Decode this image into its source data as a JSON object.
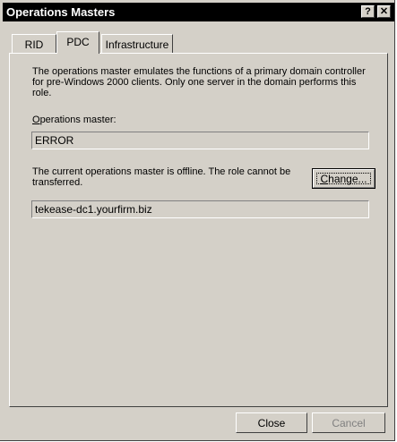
{
  "window": {
    "title": "Operations Masters",
    "help_label": "?",
    "close_label": "✕"
  },
  "tabs": [
    {
      "label": "RID",
      "active": false
    },
    {
      "label": "PDC",
      "active": true
    },
    {
      "label": "Infrastructure",
      "active": false
    }
  ],
  "pdc": {
    "description": "The operations master emulates the functions of a primary domain controller for pre-Windows 2000 clients. Only one server in the domain performs this role.",
    "master_label_underlined": "O",
    "master_label_rest": "perations master:",
    "master_value": "ERROR",
    "status_text": "The current operations master is offline. The role cannot be transferred.",
    "change_label_underlined": "C",
    "change_label_rest": "hange...",
    "target_server": "tekease-dc1.yourfirm.biz"
  },
  "footer": {
    "close_label": "Close",
    "cancel_label": "Cancel"
  }
}
